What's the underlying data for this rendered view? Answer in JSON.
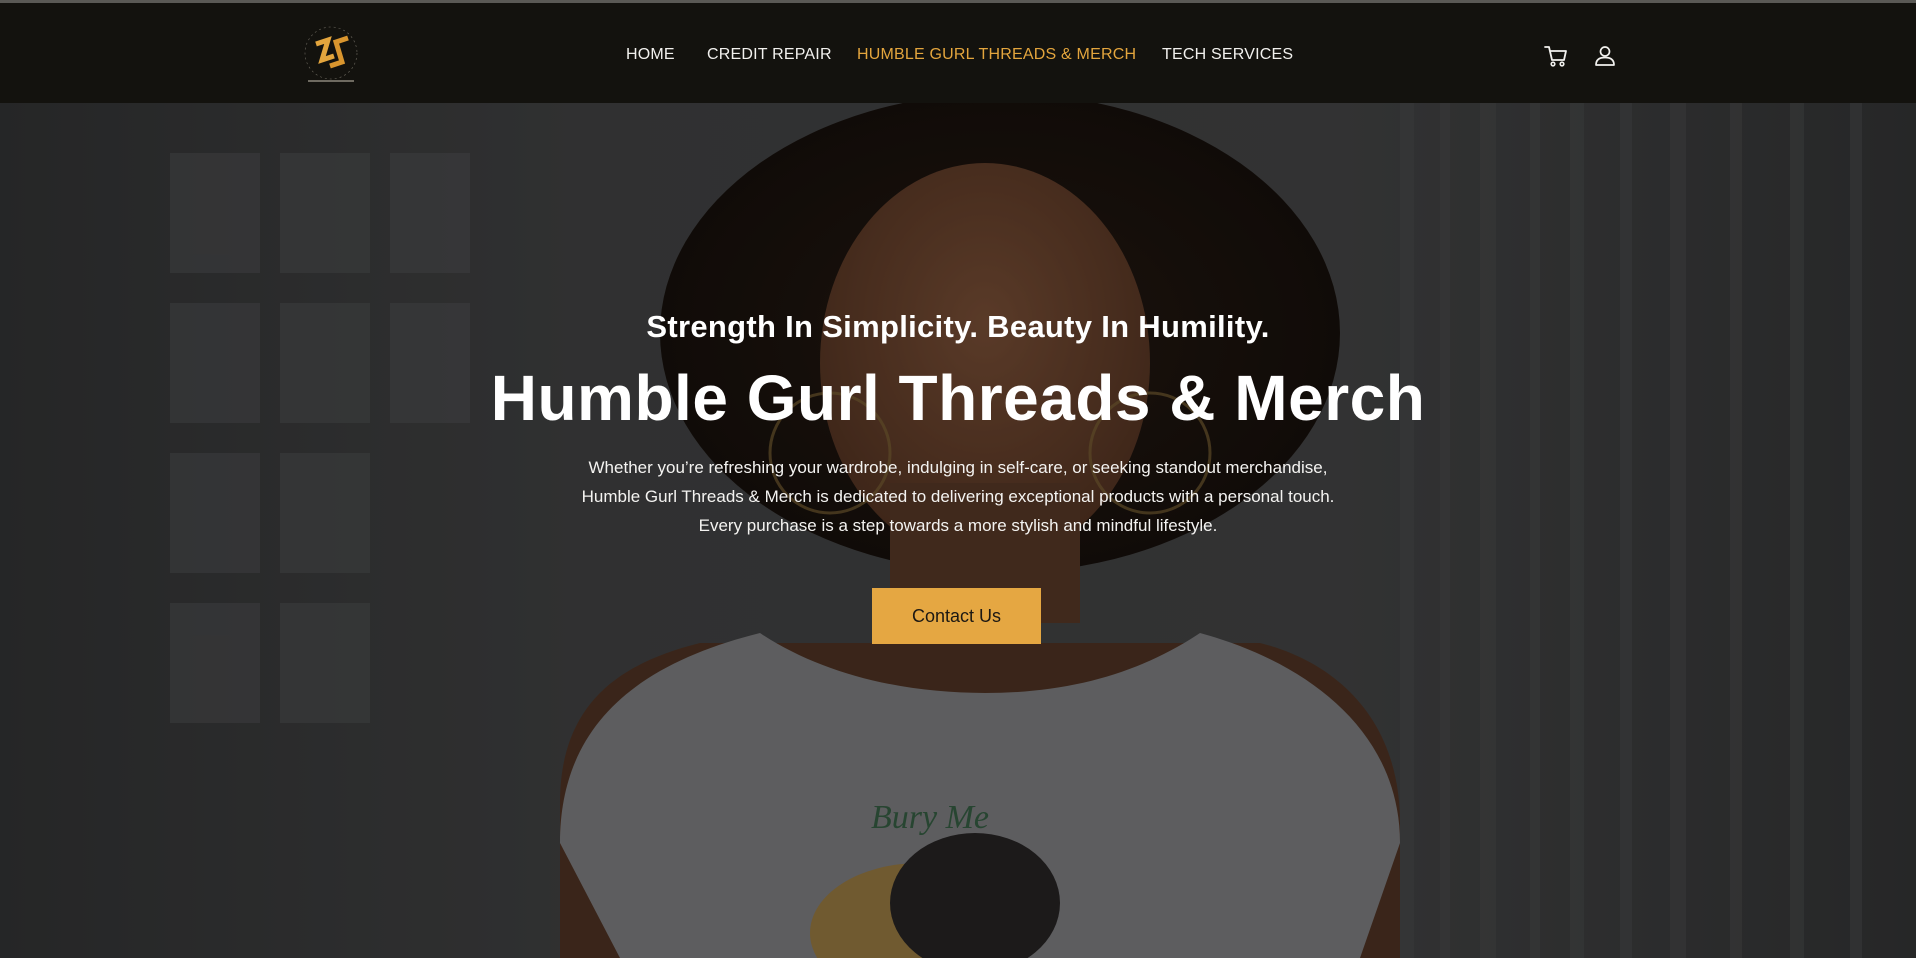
{
  "brand": {
    "logo_icon": "ds-monogram-logo",
    "accent_color": "#e3a53d",
    "header_bg": "#13120e"
  },
  "nav": {
    "items": [
      {
        "label": "HOME",
        "active": false
      },
      {
        "label": "CREDIT REPAIR",
        "active": false
      },
      {
        "label": "HUMBLE GURL THREADS & MERCH",
        "active": true
      },
      {
        "label": "TECH SERVICES",
        "active": false
      }
    ]
  },
  "header_icons": {
    "cart": "cart-icon",
    "account": "user-icon"
  },
  "hero": {
    "tagline": "Strength In Simplicity. Beauty In Humility.",
    "title": "Humble Gurl Threads & Merch",
    "description": "Whether you’re refreshing your wardrobe, indulging in self-care, or seeking standout merchandise, Humble Gurl Threads & Merch is dedicated to delivering exceptional products with a personal touch. Every purchase is a step towards a more stylish and mindful lifestyle.",
    "cta_label": "Contact Us",
    "cta_color": "#e5a742"
  }
}
